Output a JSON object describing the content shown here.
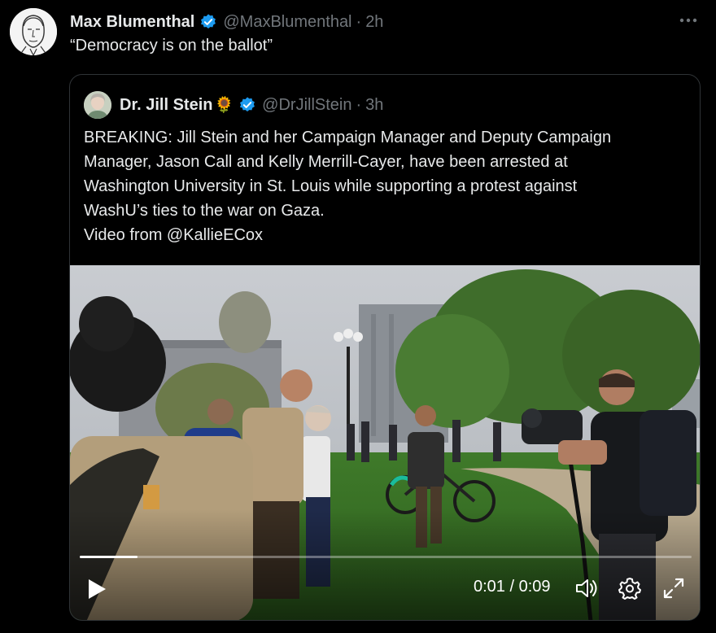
{
  "tweet": {
    "author_name": "Max Blumenthal",
    "handle": "@MaxBlumenthal",
    "separator": "·",
    "time": "2h",
    "text": "“Democracy is on the ballot”",
    "icons": {
      "avatar": "sketch-portrait-avatar",
      "verified": "verified-badge-icon",
      "more": "more-options-icon"
    }
  },
  "quoted": {
    "author_name": "Dr. Jill Stein",
    "emoji": "🌻",
    "handle": "@DrJillStein",
    "separator": "·",
    "time": "3h",
    "text_lines": [
      "BREAKING: Jill Stein and her Campaign Manager and Deputy Campaign",
      "Manager, Jason Call and Kelly Merrill-Cayer, have been arrested at",
      "Washington University in St. Louis while supporting a protest against",
      "WashU’s ties to the war on Gaza.",
      "Video from @KallieECox"
    ]
  },
  "video": {
    "current_time": "0:01",
    "duration": "0:09",
    "time_separator": "/",
    "progress_fraction": 0.095,
    "icons": [
      "play-icon",
      "volume-icon",
      "settings-gear-icon",
      "fullscreen-icon"
    ]
  },
  "colors": {
    "background": "#000000",
    "text": "#e7e9ea",
    "muted": "#71767b",
    "verified_blue": "#1d9bf0",
    "border": "#2f3336"
  }
}
